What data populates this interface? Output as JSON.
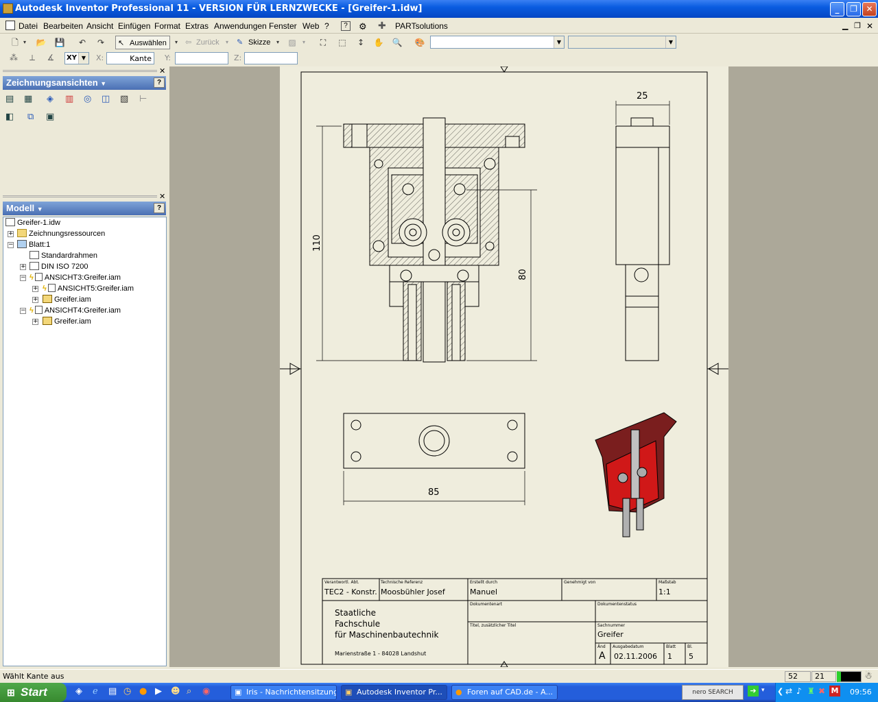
{
  "window": {
    "title": "Autodesk Inventor Professional 11 - VERSION FÜR LERNZWECKE - [Greifer-1.idw]"
  },
  "menu": [
    "Datei",
    "Bearbeiten",
    "Ansicht",
    "Einfügen",
    "Format",
    "Extras",
    "Anwendungen",
    "Fenster",
    "Web",
    "?"
  ],
  "menu_extra": "PARTsolutions",
  "toolbar": {
    "select": "Auswählen",
    "back": "Zurück",
    "sketch": "Skizze",
    "xy": "XY",
    "x": "X:",
    "kante": "Kante",
    "y": "Y:",
    "z": "Z:"
  },
  "panel1": {
    "title": "Zeichnungsansichten"
  },
  "panel2": {
    "title": "Modell"
  },
  "tree": [
    {
      "label": "Greifer-1.idw"
    },
    {
      "label": "Zeichnungsressourcen"
    },
    {
      "label": "Blatt:1"
    },
    {
      "label": "Standardrahmen"
    },
    {
      "label": "DIN ISO 7200"
    },
    {
      "label": "ANSICHT3:Greifer.iam"
    },
    {
      "label": "ANSICHT5:Greifer.iam"
    },
    {
      "label": "Greifer.iam"
    },
    {
      "label": "ANSICHT4:Greifer.iam"
    },
    {
      "label": "Greifer.iam"
    }
  ],
  "drawing": {
    "dims": {
      "width_side": "25",
      "height_front": "110",
      "height_inner": "80",
      "width_top": "85"
    },
    "titleblock": {
      "verantw_label": "Verantwortl. Abt.",
      "verantw": "TEC2 - Konstr.",
      "techref_label": "Technische Referenz",
      "techref": "Moosbühler Josef",
      "erstellt_label": "Erstellt durch",
      "erstellt": "Manuel",
      "genehmigt_label": "Genehmigt von",
      "massstab_label": "Maßstab",
      "massstab": "1:1",
      "dokart_label": "Dokumentenart",
      "dokstatus_label": "Dokumentenstatus",
      "titel_label": "Titel, zusätzlicher Titel",
      "sachnr_label": "Sachnummer",
      "sachnr": "Greifer",
      "aend_label": "Änd",
      "aend": "A",
      "datum_label": "Ausgabedatum",
      "datum": "02.11.2006",
      "blatt_label": "Blatt",
      "blatt": "1",
      "bl_label": "Bl.",
      "bl": "5",
      "school1": "Staatliche",
      "school2": "Fachschule",
      "school3": "für Maschinenbautechnik",
      "address": "Marienstraße 1 - 84028 Landshut"
    }
  },
  "status": {
    "text": "Wählt Kante aus",
    "v1": "52",
    "v2": "21"
  },
  "taskbar": {
    "start": "Start",
    "tasks": [
      "Iris - Nachrichtensitzung",
      "Autodesk Inventor Pr...",
      "Foren auf CAD.de - A..."
    ],
    "nero": "nero SEARCH",
    "clock": "09:56"
  }
}
